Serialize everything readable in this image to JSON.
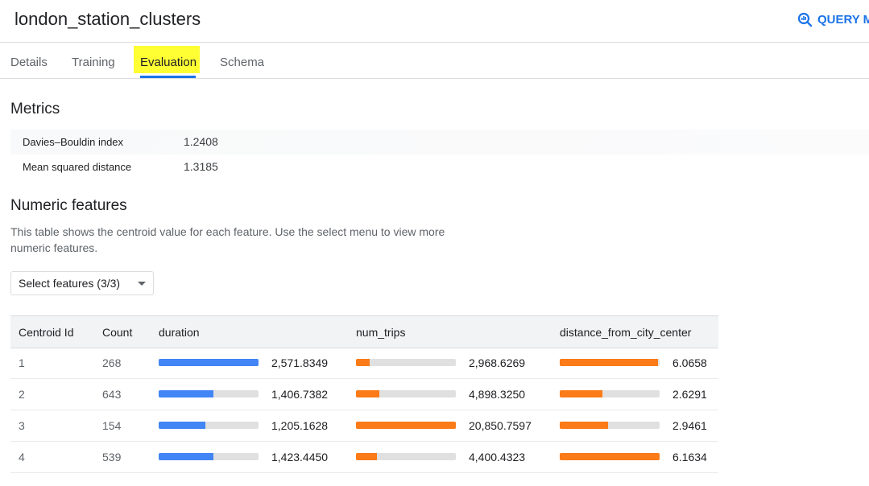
{
  "header": {
    "title": "london_station_clusters",
    "query_label": "QUERY M"
  },
  "tabs": [
    {
      "label": "Details",
      "active": false
    },
    {
      "label": "Training",
      "active": false
    },
    {
      "label": "Evaluation",
      "active": true
    },
    {
      "label": "Schema",
      "active": false
    }
  ],
  "metrics": {
    "heading": "Metrics",
    "rows": [
      {
        "label": "Davies–Bouldin index",
        "value": "1.2408"
      },
      {
        "label": "Mean squared distance",
        "value": "1.3185"
      }
    ]
  },
  "numeric_features": {
    "heading": "Numeric features",
    "description": "This table shows the centroid value for each feature. Use the select menu to view more numeric features.",
    "select_label": "Select features (3/3)"
  },
  "table": {
    "columns": [
      "Centroid Id",
      "Count",
      "duration",
      "num_trips",
      "distance_from_city_center"
    ],
    "bar_colors": {
      "duration": "#4285f4",
      "num_trips": "#fa7b17",
      "distance_from_city_center": "#fa7b17"
    },
    "rows": [
      {
        "centroid_id": "1",
        "count": "268",
        "duration": {
          "value": "2,571.8349",
          "fraction": 1.0
        },
        "num_trips": {
          "value": "2,968.6269",
          "fraction": 0.14
        },
        "distance": {
          "value": "6.0658",
          "fraction": 0.98
        }
      },
      {
        "centroid_id": "2",
        "count": "643",
        "duration": {
          "value": "1,406.7382",
          "fraction": 0.55
        },
        "num_trips": {
          "value": "4,898.3250",
          "fraction": 0.23
        },
        "distance": {
          "value": "2.6291",
          "fraction": 0.43
        }
      },
      {
        "centroid_id": "3",
        "count": "154",
        "duration": {
          "value": "1,205.1628",
          "fraction": 0.47
        },
        "num_trips": {
          "value": "20,850.7597",
          "fraction": 1.0
        },
        "distance": {
          "value": "2.9461",
          "fraction": 0.48
        }
      },
      {
        "centroid_id": "4",
        "count": "539",
        "duration": {
          "value": "1,423.4450",
          "fraction": 0.55
        },
        "num_trips": {
          "value": "4,400.4323",
          "fraction": 0.21
        },
        "distance": {
          "value": "6.1634",
          "fraction": 1.0
        }
      }
    ]
  }
}
